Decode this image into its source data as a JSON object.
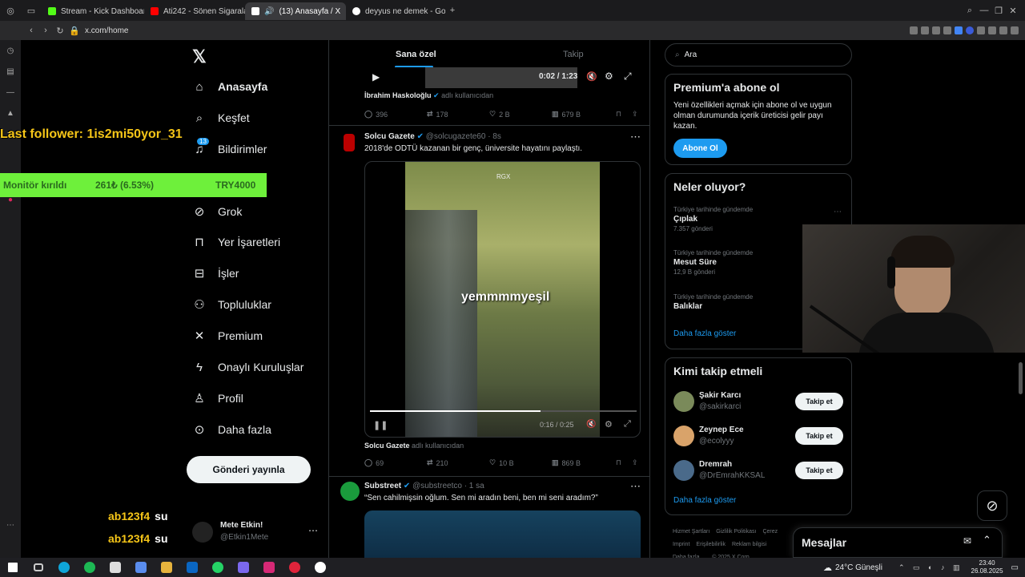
{
  "browser": {
    "tabs": [
      {
        "title": "Stream - Kick Dashboard",
        "color": "#53fc18"
      },
      {
        "title": "Ati242 - Sönen Sigaralar",
        "color": "#ff0000"
      },
      {
        "title": "(13) Anasayfa / X",
        "color": "#ffffff"
      },
      {
        "title": "deyyus ne demek - Goog",
        "color": "#ffffff"
      }
    ],
    "url": "x.com/home"
  },
  "overlay": {
    "last_follower": "Last follower: 1is2mi50yor_31",
    "goal_label": "Monitör kırıldı",
    "goal_amount": "261₺ (6.53%)",
    "goal_target": "TRY4000",
    "goal_progress": 0.0653,
    "chat": [
      {
        "user": "ab123f4",
        "msg": "su"
      },
      {
        "user": "ab123f4",
        "msg": "su"
      }
    ]
  },
  "nav": {
    "items": [
      {
        "label": "Anasayfa",
        "icon": "home-icon"
      },
      {
        "label": "Keşfet",
        "icon": "search-icon"
      },
      {
        "label": "Bildirimler",
        "icon": "bell-icon",
        "badge": "13"
      },
      {
        "label": "Grok",
        "icon": "grok-icon"
      },
      {
        "label": "Yer İşaretleri",
        "icon": "bookmark-icon"
      },
      {
        "label": "İşler",
        "icon": "briefcase-icon"
      },
      {
        "label": "Topluluklar",
        "icon": "people-icon"
      },
      {
        "label": "Premium",
        "icon": "x-logo-icon"
      },
      {
        "label": "Onaylı Kuruluşlar",
        "icon": "lightning-icon"
      },
      {
        "label": "Profil",
        "icon": "person-icon"
      },
      {
        "label": "Daha fazla",
        "icon": "more-circle-icon"
      }
    ],
    "post_button": "Gönderi yayınla",
    "account_name": "Mete Etkin!",
    "account_handle": "@Etkin1Mete"
  },
  "feed": {
    "tabs": [
      "Sana özel",
      "Takip"
    ],
    "video1": {
      "time": "0:02 / 1:23",
      "credit_name": "İbrahim Haskoloğlu",
      "credit_suffix": "adlı kullanıcıdan",
      "replies": "396",
      "reposts": "178",
      "likes": "2 B",
      "views": "679 B"
    },
    "post2": {
      "name": "Solcu Gazete",
      "handle": "@solcugazete60 · 8s",
      "text": "2018'de ODTÜ kazanan bir genç, üniversite hayatını paylaştı.",
      "video_caption": "yemmmmyeşil",
      "video_watermark": "RGX",
      "video_time": "0:16 / 0:25",
      "credit_name": "Solcu Gazete",
      "credit_suffix": "adlı kullanıcıdan",
      "replies": "69",
      "reposts": "210",
      "likes": "10 B",
      "views": "869 B"
    },
    "post3": {
      "name": "Substreet",
      "handle": "@substreetco · 1 sa",
      "text": "“Sen cahilmişsin oğlum. Sen mi aradın beni, ben mi seni aradım?”"
    }
  },
  "right": {
    "search_placeholder": "Ara",
    "premium": {
      "title": "Premium'a abone ol",
      "text": "Yeni özellikleri açmak için abone ol ve uygun olman durumunda içerik üreticisi gelir payı kazan.",
      "button": "Abone Ol"
    },
    "trends": {
      "title": "Neler oluyor?",
      "items": [
        {
          "context": "Türkiye tarihinde gündemde",
          "name": "Çıplak",
          "count": "7.357 gönderi"
        },
        {
          "context": "Türkiye tarihinde gündemde",
          "name": "Mesut Süre",
          "count": "12,9 B gönderi"
        },
        {
          "context": "Türkiye tarihinde gündemde",
          "name": "Balıklar",
          "count": ""
        }
      ],
      "more": "Daha fazla göster"
    },
    "follow": {
      "title": "Kimi takip etmeli",
      "items": [
        {
          "name": "Şakir Karcı",
          "handle": "@sakirkarci",
          "button": "Takip et"
        },
        {
          "name": "Zeynep Ece",
          "handle": "@ecolyyy",
          "button": "Takip et"
        },
        {
          "name": "Dremrah",
          "handle": "@DrEmrahKKSAL",
          "button": "Takip et"
        }
      ],
      "more": "Daha fazla göster"
    },
    "footer": [
      "Hizmet Şartları",
      "Gizlilik Politikası",
      "Çerez",
      "Imprint",
      "Erişilebilirlik",
      "Reklam bilgisi",
      "Daha fazla ...",
      "© 2025 X Corp."
    ],
    "messages": "Mesajlar"
  },
  "taskbar": {
    "weather": "24°C Güneşli",
    "time": "23:40",
    "date": "26.08.2025"
  }
}
